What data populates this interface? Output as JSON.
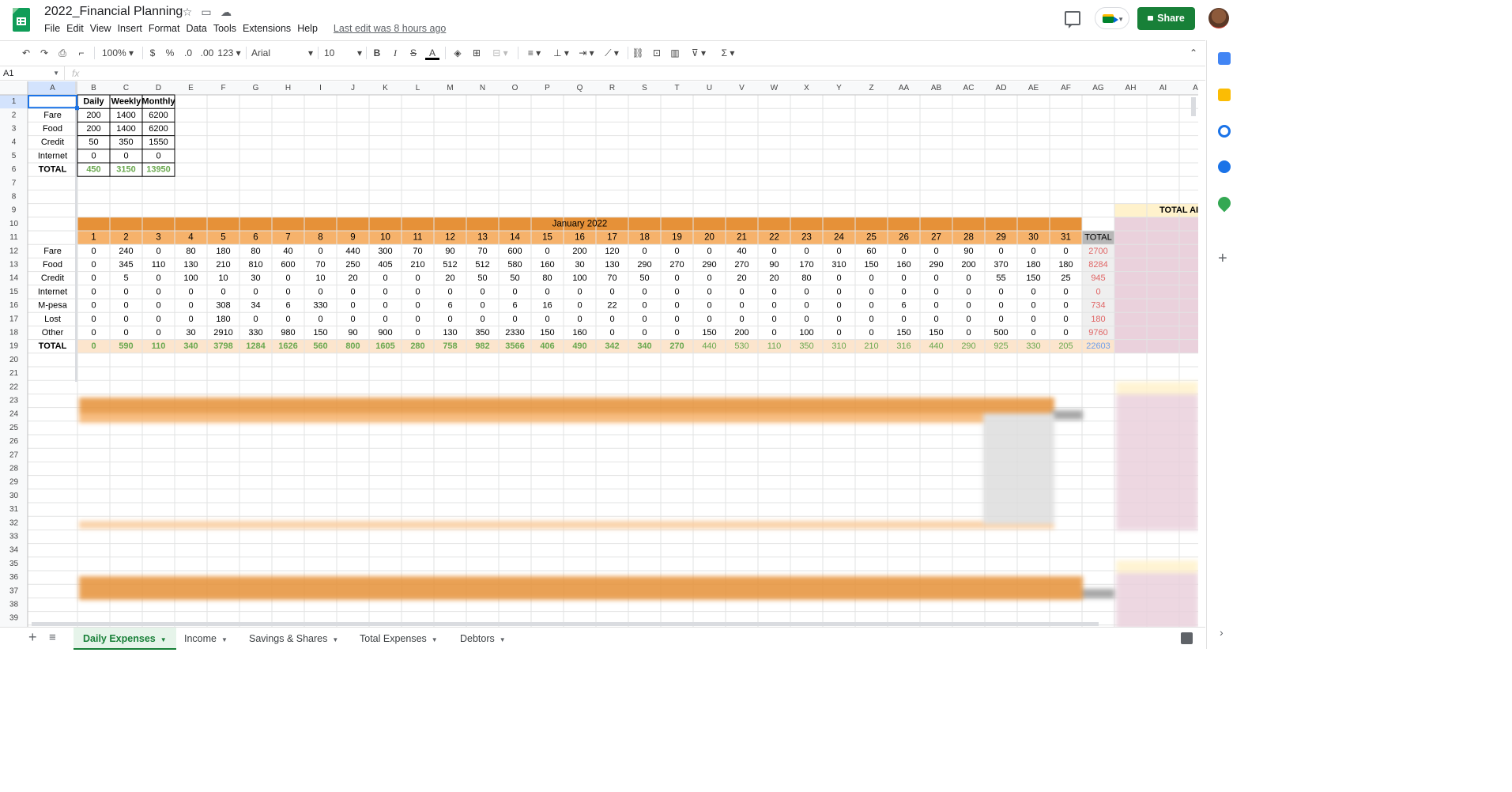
{
  "app": {
    "title": "2022_Financial Planning",
    "menus": [
      "File",
      "Edit",
      "View",
      "Insert",
      "Format",
      "Data",
      "Tools",
      "Extensions",
      "Help"
    ],
    "last_edit": "Last edit was 8 hours ago",
    "share_label": "Share",
    "colors": {
      "brand_green": "#188038",
      "logo_green": "#0f9d58"
    }
  },
  "toolbar": {
    "zoom": "100%",
    "currency": "$",
    "percent": "%",
    "decimal_decrease": ".0",
    "decimal_increase": ".00",
    "number_format": "123",
    "font": "Arial",
    "font_size": "10",
    "icons": [
      "undo-icon",
      "redo-icon",
      "print-icon",
      "paint-format-icon",
      "bold-icon",
      "italic-icon",
      "strikethrough-icon",
      "text-color-icon",
      "fill-color-icon",
      "borders-icon",
      "merge-icon",
      "align-icon",
      "valign-icon",
      "wrap-icon",
      "rotate-icon",
      "link-icon",
      "comment-icon",
      "chart-icon",
      "filter-icon",
      "functions-icon"
    ]
  },
  "formula": {
    "cell_ref": "A1",
    "fx": "fx",
    "value": ""
  },
  "grid": {
    "columns": [
      "A",
      "B",
      "C",
      "D",
      "E",
      "F",
      "G",
      "H",
      "I",
      "J",
      "K",
      "L",
      "M",
      "N",
      "O",
      "P",
      "Q",
      "R",
      "S",
      "T",
      "U",
      "V",
      "W",
      "X",
      "Y",
      "Z",
      "AA",
      "AB",
      "AC",
      "AD",
      "AE",
      "AF",
      "AG",
      "AH",
      "AI",
      "A"
    ],
    "row_numbers": [
      "1",
      "2",
      "3",
      "4",
      "5",
      "6",
      "7",
      "8",
      "9",
      "10",
      "11",
      "12",
      "13",
      "14",
      "15",
      "16",
      "17",
      "18",
      "19",
      "20",
      "21",
      "22",
      "23",
      "24",
      "25",
      "26",
      "27",
      "28",
      "29",
      "30",
      "31",
      "32",
      "33",
      "34",
      "35",
      "36",
      "37",
      "38",
      "39"
    ],
    "budget_table": {
      "headers": [
        "Daily",
        "Weekly",
        "Monthly"
      ],
      "rows": [
        {
          "label": "Fare",
          "values": [
            "200",
            "1400",
            "6200"
          ]
        },
        {
          "label": "Food",
          "values": [
            "200",
            "1400",
            "6200"
          ]
        },
        {
          "label": "Credit",
          "values": [
            "50",
            "350",
            "1550"
          ]
        },
        {
          "label": "Internet",
          "values": [
            "0",
            "0",
            "0"
          ]
        }
      ],
      "total": {
        "label": "TOTAL",
        "values": [
          "450",
          "3150",
          "13950"
        ]
      }
    },
    "month_table": {
      "month": "January 2022",
      "days": [
        "1",
        "2",
        "3",
        "4",
        "5",
        "6",
        "7",
        "8",
        "9",
        "10",
        "11",
        "12",
        "13",
        "14",
        "15",
        "16",
        "17",
        "18",
        "19",
        "20",
        "21",
        "22",
        "23",
        "24",
        "25",
        "26",
        "27",
        "28",
        "29",
        "30",
        "31"
      ],
      "total_header": "TOTAL",
      "side_header": "TOTAL AI",
      "rows": [
        {
          "label": "Fare",
          "values": [
            "0",
            "240",
            "0",
            "80",
            "180",
            "80",
            "40",
            "0",
            "440",
            "300",
            "70",
            "90",
            "70",
            "600",
            "0",
            "200",
            "120",
            "0",
            "0",
            "0",
            "40",
            "0",
            "0",
            "0",
            "60",
            "0",
            "0",
            "90",
            "0",
            "0",
            "0"
          ],
          "total": "2700"
        },
        {
          "label": "Food",
          "values": [
            "0",
            "345",
            "110",
            "130",
            "210",
            "810",
            "600",
            "70",
            "250",
            "405",
            "210",
            "512",
            "512",
            "580",
            "160",
            "30",
            "130",
            "290",
            "270",
            "290",
            "270",
            "90",
            "170",
            "310",
            "150",
            "160",
            "290",
            "200",
            "370",
            "180",
            "180"
          ],
          "total": "8284"
        },
        {
          "label": "Credit",
          "values": [
            "0",
            "5",
            "0",
            "100",
            "10",
            "30",
            "0",
            "10",
            "20",
            "0",
            "0",
            "20",
            "50",
            "50",
            "80",
            "100",
            "70",
            "50",
            "0",
            "0",
            "20",
            "20",
            "80",
            "0",
            "0",
            "0",
            "0",
            "0",
            "55",
            "150",
            "25"
          ],
          "total": "945"
        },
        {
          "label": "Internet",
          "values": [
            "0",
            "0",
            "0",
            "0",
            "0",
            "0",
            "0",
            "0",
            "0",
            "0",
            "0",
            "0",
            "0",
            "0",
            "0",
            "0",
            "0",
            "0",
            "0",
            "0",
            "0",
            "0",
            "0",
            "0",
            "0",
            "0",
            "0",
            "0",
            "0",
            "0",
            "0"
          ],
          "total": "0"
        },
        {
          "label": "M-pesa",
          "values": [
            "0",
            "0",
            "0",
            "0",
            "308",
            "34",
            "6",
            "330",
            "0",
            "0",
            "0",
            "6",
            "0",
            "6",
            "16",
            "0",
            "22",
            "0",
            "0",
            "0",
            "0",
            "0",
            "0",
            "0",
            "0",
            "6",
            "0",
            "0",
            "0",
            "0",
            "0"
          ],
          "total": "734"
        },
        {
          "label": "Lost",
          "values": [
            "0",
            "0",
            "0",
            "0",
            "180",
            "0",
            "0",
            "0",
            "0",
            "0",
            "0",
            "0",
            "0",
            "0",
            "0",
            "0",
            "0",
            "0",
            "0",
            "0",
            "0",
            "0",
            "0",
            "0",
            "0",
            "0",
            "0",
            "0",
            "0",
            "0",
            "0"
          ],
          "total": "180"
        },
        {
          "label": "Other",
          "values": [
            "0",
            "0",
            "0",
            "30",
            "2910",
            "330",
            "980",
            "150",
            "90",
            "900",
            "0",
            "130",
            "350",
            "2330",
            "150",
            "160",
            "0",
            "0",
            "0",
            "150",
            "200",
            "0",
            "100",
            "0",
            "0",
            "150",
            "150",
            "0",
            "500",
            "0",
            "0"
          ],
          "total": "9760"
        }
      ],
      "total_row": {
        "label": "TOTAL",
        "values": [
          "0",
          "590",
          "110",
          "340",
          "3798",
          "1284",
          "1626",
          "560",
          "800",
          "1605",
          "280",
          "758",
          "982",
          "3566",
          "406",
          "490",
          "342",
          "340",
          "270",
          "440",
          "530",
          "110",
          "350",
          "310",
          "210",
          "316",
          "440",
          "290",
          "925",
          "330",
          "205"
        ],
        "total": "22603"
      }
    },
    "colors": {
      "month_header": "#e69138",
      "day_header": "#f6b26b",
      "total_row": "#fce5cd",
      "green_text": "#6aa84f",
      "red_text": "#e06666",
      "blue_text": "#6d9eeb",
      "total_header_grey": "#b7b7b7",
      "side_yellow": "#fff2cc",
      "side_pink": "#ead1dc"
    }
  },
  "sheet_tabs": [
    {
      "label": "Daily Expenses",
      "active": true
    },
    {
      "label": "Income",
      "active": false
    },
    {
      "label": "Savings & Shares",
      "active": false
    },
    {
      "label": "Total Expenses",
      "active": false
    },
    {
      "label": "Debtors",
      "active": false
    }
  ]
}
